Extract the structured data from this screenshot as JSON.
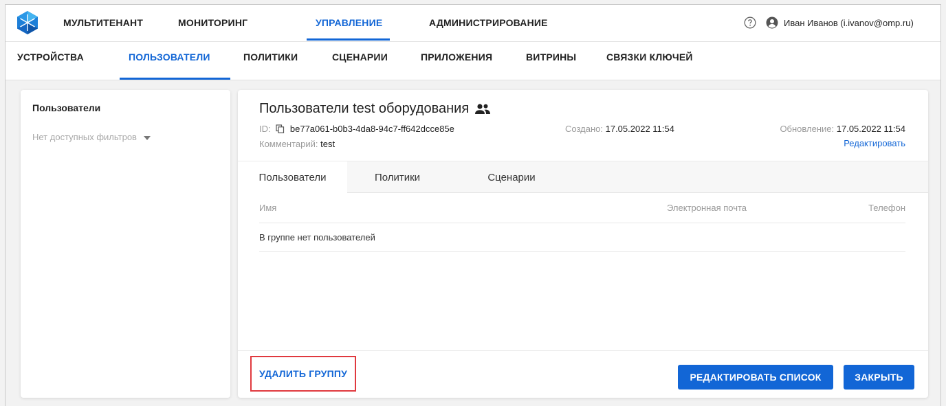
{
  "header": {
    "nav": [
      {
        "label": "МУЛЬТИТЕНАНТ",
        "active": false
      },
      {
        "label": "МОНИТОРИНГ",
        "active": false
      },
      {
        "label": "УПРАВЛЕНИЕ",
        "active": true
      },
      {
        "label": "АДМИНИСТРИРОВАНИЕ",
        "active": false
      }
    ],
    "help_icon": "help-circle-icon",
    "user_icon": "account-circle-icon",
    "user_name": "Иван Иванов (i.ivanov@omp.ru)"
  },
  "subnav": [
    {
      "label": "УСТРОЙСТВА",
      "active": false
    },
    {
      "label": "ПОЛЬЗОВАТЕЛИ",
      "active": true
    },
    {
      "label": "ПОЛИТИКИ",
      "active": false
    },
    {
      "label": "СЦЕНАРИИ",
      "active": false
    },
    {
      "label": "ПРИЛОЖЕНИЯ",
      "active": false
    },
    {
      "label": "ВИТРИНЫ",
      "active": false
    },
    {
      "label": "СВЯЗКИ КЛЮЧЕЙ",
      "active": false
    }
  ],
  "sidebar": {
    "title": "Пользователи",
    "filter_placeholder": "Нет доступных фильтров"
  },
  "group": {
    "title": "Пользователи test оборудования",
    "id_label": "ID:",
    "id_value": "be77a061-b0b3-4da8-94c7-ff642dcce85e",
    "comment_label": "Комментарий:",
    "comment_value": "test",
    "created_label": "Создано:",
    "created_value": "17.05.2022 11:54",
    "updated_label": "Обновление:",
    "updated_value": "17.05.2022 11:54",
    "edit_link": "Редактировать"
  },
  "tabs": [
    {
      "label": "Пользователи",
      "active": true
    },
    {
      "label": "Политики",
      "active": false
    },
    {
      "label": "Сценарии",
      "active": false
    }
  ],
  "table": {
    "columns": [
      "Имя",
      "Электронная почта",
      "Телефон"
    ],
    "empty_text": "В группе нет пользователей"
  },
  "actions": {
    "delete_group": "УДАЛИТЬ ГРУППУ",
    "edit_list": "РЕДАКТИРОВАТЬ СПИСОК",
    "close": "ЗАКРЫТЬ"
  },
  "colors": {
    "accent": "#1266d6",
    "highlight": "#e0393e"
  }
}
